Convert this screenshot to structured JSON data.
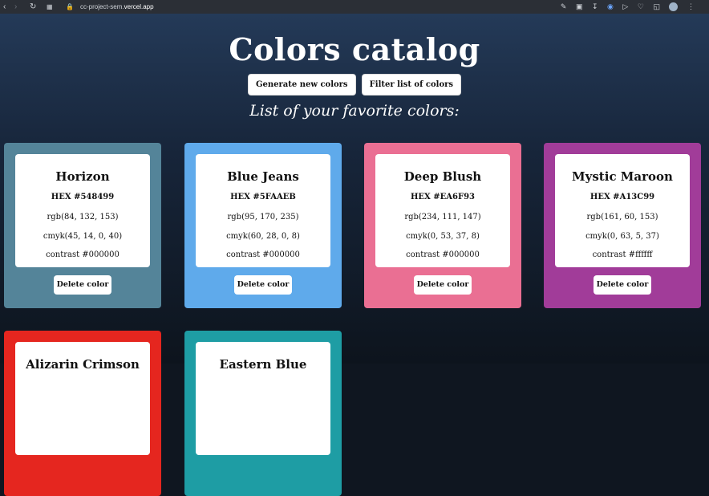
{
  "browser": {
    "url_prefix": "cc-project-sem.",
    "url_domain": "vercel.app"
  },
  "page": {
    "title": "Colors catalog",
    "generate_label": "Generate new colors",
    "filter_label": "Filter list of colors",
    "subtitle": "List of your favorite colors:",
    "delete_label": "Delete color"
  },
  "cards": [
    {
      "name": "Horizon",
      "hex": "HEX #548499",
      "rgb": "rgb(84, 132, 153)",
      "cmyk": "cmyk(45, 14, 0, 40)",
      "contrast": "contrast #000000",
      "color": "#548499"
    },
    {
      "name": "Blue Jeans",
      "hex": "HEX #5FAAEB",
      "rgb": "rgb(95, 170, 235)",
      "cmyk": "cmyk(60, 28, 0, 8)",
      "contrast": "contrast #000000",
      "color": "#5FAAEB"
    },
    {
      "name": "Deep Blush",
      "hex": "HEX #EA6F93",
      "rgb": "rgb(234, 111, 147)",
      "cmyk": "cmyk(0, 53, 37, 8)",
      "contrast": "contrast #000000",
      "color": "#EA6F93"
    },
    {
      "name": "Mystic Maroon",
      "hex": "HEX #A13C99",
      "rgb": "rgb(161, 60, 153)",
      "cmyk": "cmyk(0, 63, 5, 37)",
      "contrast": "contrast #ffffff",
      "color": "#A13C99"
    },
    {
      "name": "Alizarin Crimson",
      "color": "#E5261F"
    },
    {
      "name": "Eastern Blue",
      "color": "#1E9DA4"
    }
  ]
}
